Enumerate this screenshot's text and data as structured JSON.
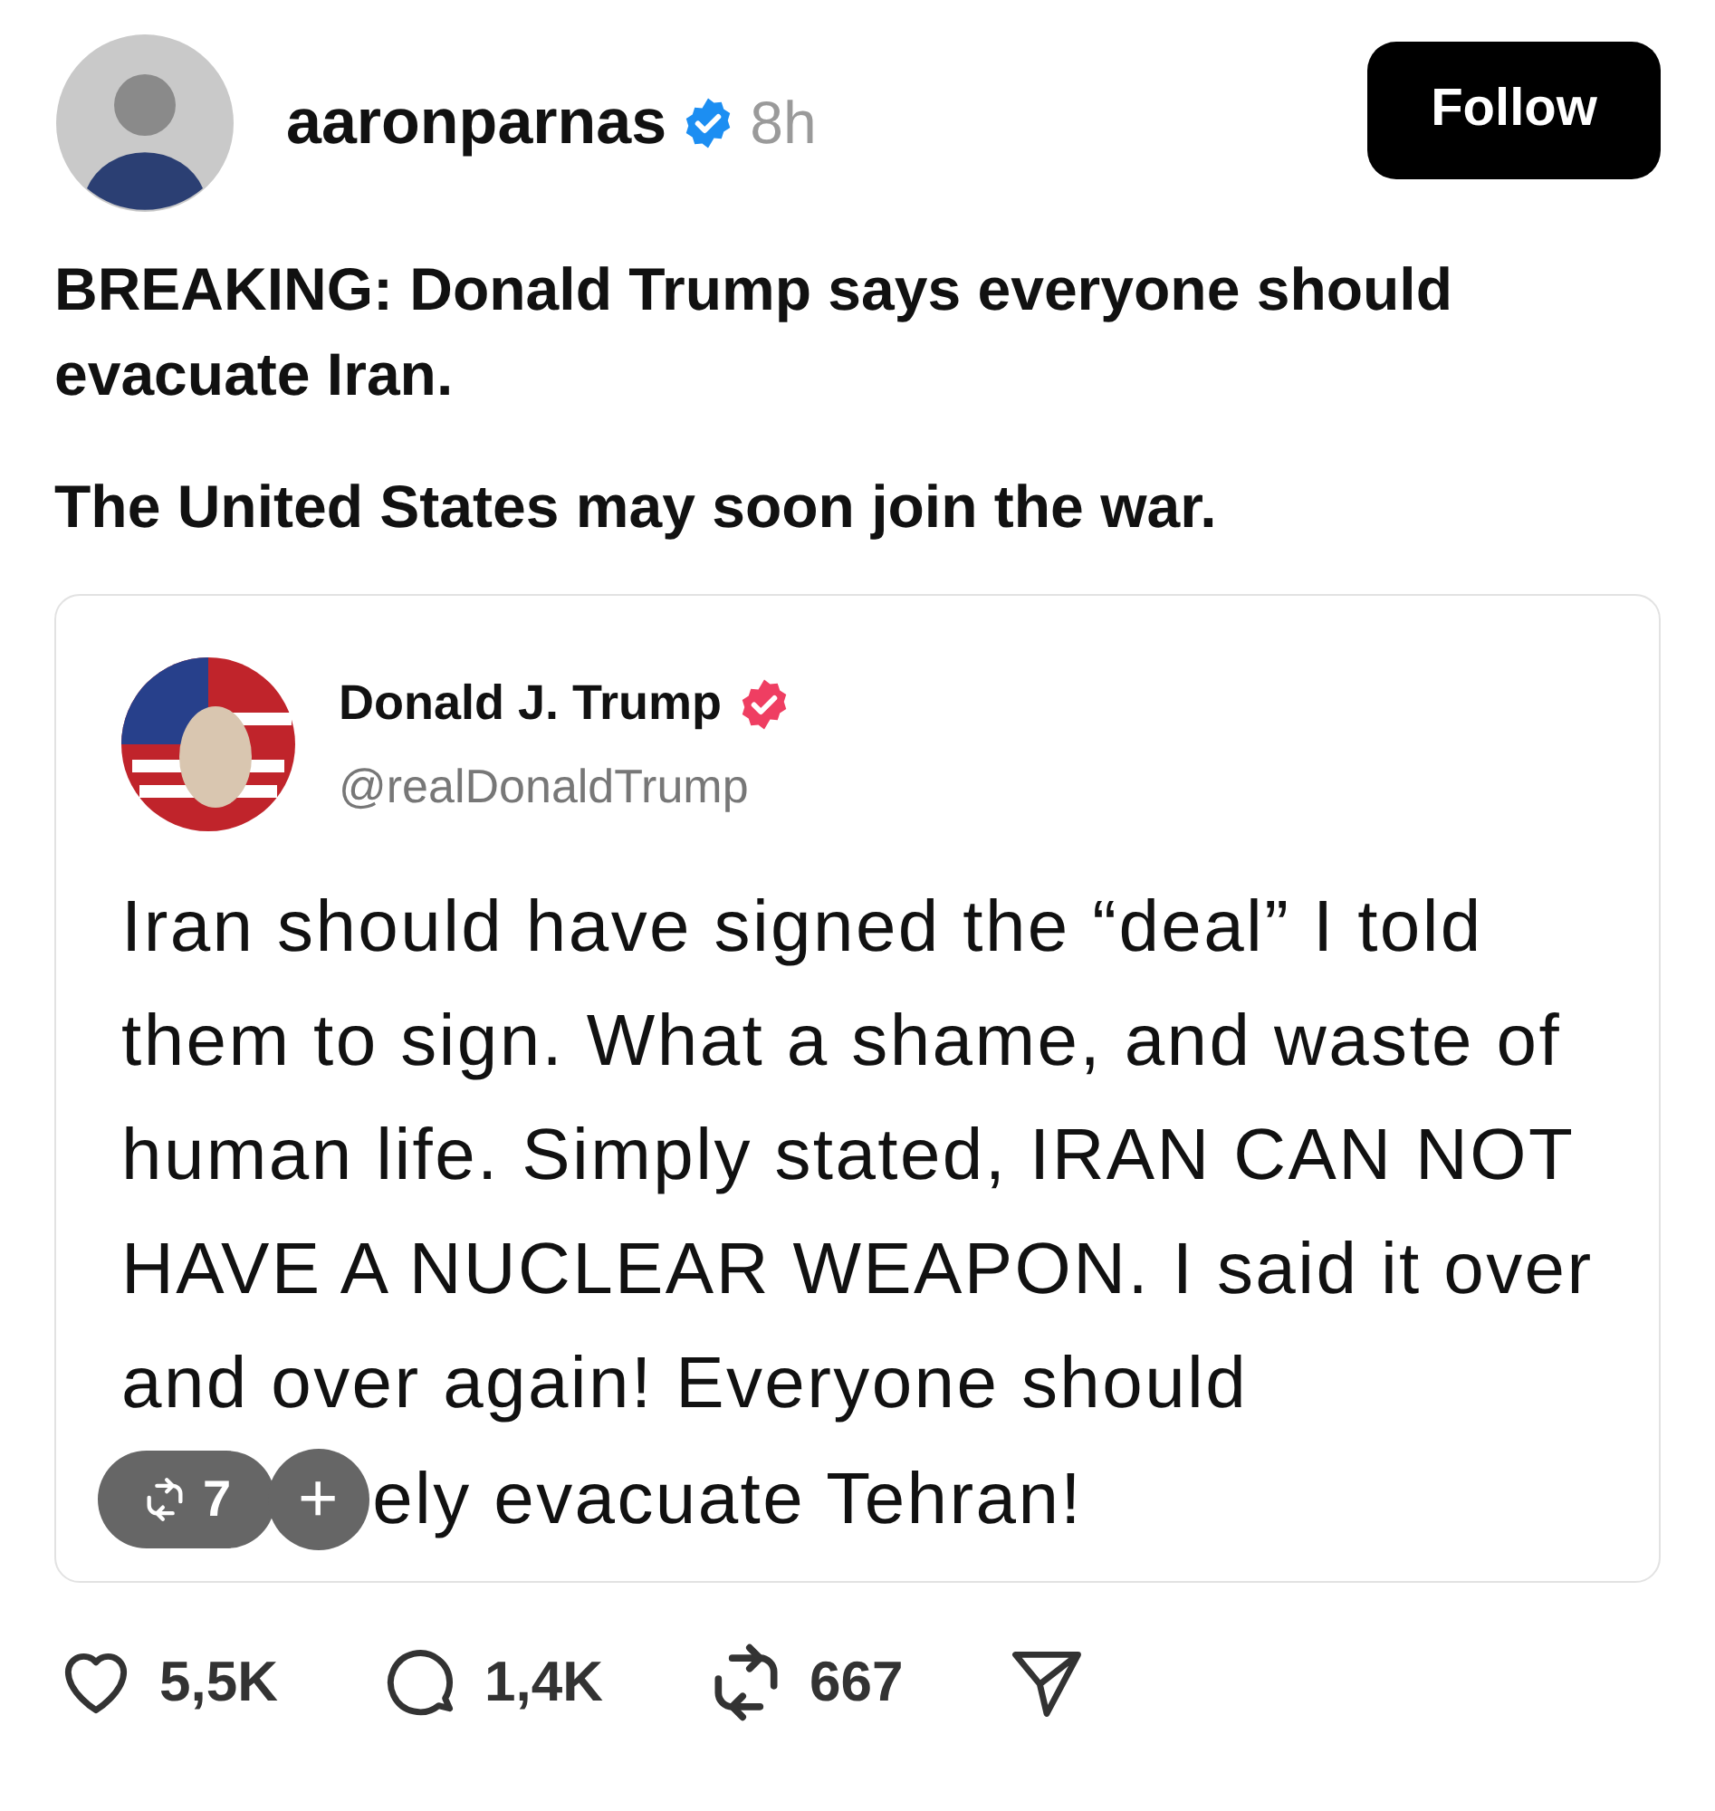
{
  "post": {
    "username": "aaronparnas",
    "verified": true,
    "time": "8h",
    "follow_button": "Follow",
    "paragraphs": [
      "BREAKING: Donald Trump says everyone should evacuate Iran.",
      "The United States may soon join the war."
    ],
    "quote": {
      "name": "Donald J. Trump",
      "verified": true,
      "handle": "@realDonaldTrump",
      "text": "Iran should have signed the “deal” I told them to sign. What a shame, and waste of human life. Simply stated, IRAN CAN NOT HAVE A NUCLEAR WEAPON. I said it over and over again! Everyone should",
      "last_line_visible": "ely evacuate Tehran!",
      "repost_count": "7",
      "add_label": "+"
    },
    "actions": [
      {
        "kind": "like",
        "count": "5,5K"
      },
      {
        "kind": "reply",
        "count": "1,4K"
      },
      {
        "kind": "repost",
        "count": "667"
      },
      {
        "kind": "share"
      }
    ]
  }
}
